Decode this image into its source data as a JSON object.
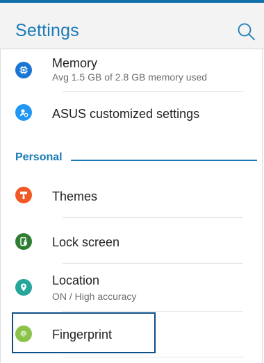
{
  "header": {
    "title": "Settings",
    "search_icon": "search-icon"
  },
  "items_top": [
    {
      "key": "memory",
      "label": "Memory",
      "sub": "Avg 1.5 GB of 2.8 GB memory used",
      "icon": "chip-icon",
      "color": "#1976d2"
    },
    {
      "key": "asus",
      "label": "ASUS customized settings",
      "icon": "asus-settings-icon",
      "color": "#2196f3"
    }
  ],
  "section": {
    "label": "Personal"
  },
  "items_personal": [
    {
      "key": "themes",
      "label": "Themes",
      "icon": "paint-roller-icon",
      "color": "#f15a24"
    },
    {
      "key": "lock",
      "label": "Lock screen",
      "icon": "lock-screen-icon",
      "color": "#2e7d32"
    },
    {
      "key": "location",
      "label": "Location",
      "sub": "ON / High accuracy",
      "icon": "location-pin-icon",
      "color": "#26a69a"
    },
    {
      "key": "fingerprint",
      "label": "Fingerprint",
      "icon": "fingerprint-icon",
      "color": "#8bc34a"
    }
  ],
  "colors": {
    "accent": "#1a7ab8",
    "highlight_border": "#0e4f86"
  }
}
